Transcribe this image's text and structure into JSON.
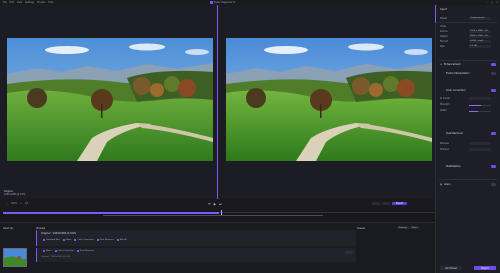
{
  "menubar": {
    "items": [
      "File",
      "Edit",
      "View",
      "Settings",
      "Process",
      "Help"
    ],
    "window_title": "Topaz Gigapixel AI"
  },
  "viewer": {
    "left_caption_title": "Original",
    "left_caption_sub": "1920x1080 @ 0.0%",
    "right_chips": [
      "Standard Max",
      "Color Correction",
      "Dust Remover"
    ]
  },
  "transport": {
    "zoom": "100%",
    "frame": "1/1",
    "export_label": "Export"
  },
  "history": {
    "title": "Preview",
    "card1_title": "Original · 1920x1080 @ 0.0%",
    "card1_sub": "",
    "card1_tags": [
      "Standard Max",
      "Noise",
      "Color Correction",
      "Dust Remover",
      "Blur AI"
    ],
    "card2_title": "Original · 1920x1080 @ 0.0%",
    "card2_tags": [
      "Noise",
      "Color Correction",
      "Dust Remover"
    ],
    "card2_sub": "Original · 1920x1080 @ 0.0%"
  },
  "left_panel": {
    "title": "Input (1)"
  },
  "queue": {
    "title": "Queue",
    "buttons": [
      "Process",
      "Clear"
    ]
  },
  "side": {
    "title": "Input",
    "preset_label": "Preset",
    "preset_value": "Custom preset",
    "video_label": "Video",
    "rows": [
      {
        "label": "Source",
        "value": "1920 x 1080 • 30"
      },
      {
        "label": "Output",
        "value": "3840 x 2160 • 30"
      },
      {
        "label": "Format",
        "value": "H.264 • mp4"
      },
      {
        "label": "Size",
        "value": "1.2 GB"
      }
    ],
    "sections": [
      {
        "label": "Enhancement",
        "on": true
      },
      {
        "label": "Frame Interpolation",
        "on": false
      },
      {
        "label": "Color Correction",
        "on": true
      },
      {
        "label": "Dust Remover",
        "on": true
      },
      {
        "label": "Stabilization",
        "on": true
      },
      {
        "label": "Grain",
        "on": false
      }
    ],
    "sub_rows": [
      {
        "label": "AI model"
      },
      {
        "label": "Strength"
      },
      {
        "label": "Detail"
      },
      {
        "label": "Denoise"
      },
      {
        "label": "Sharpen"
      }
    ],
    "cancel_label": "Add Preset",
    "apply_label": "Export"
  },
  "colors": {
    "accent": "#7a5af8",
    "bg": "#17171d"
  }
}
